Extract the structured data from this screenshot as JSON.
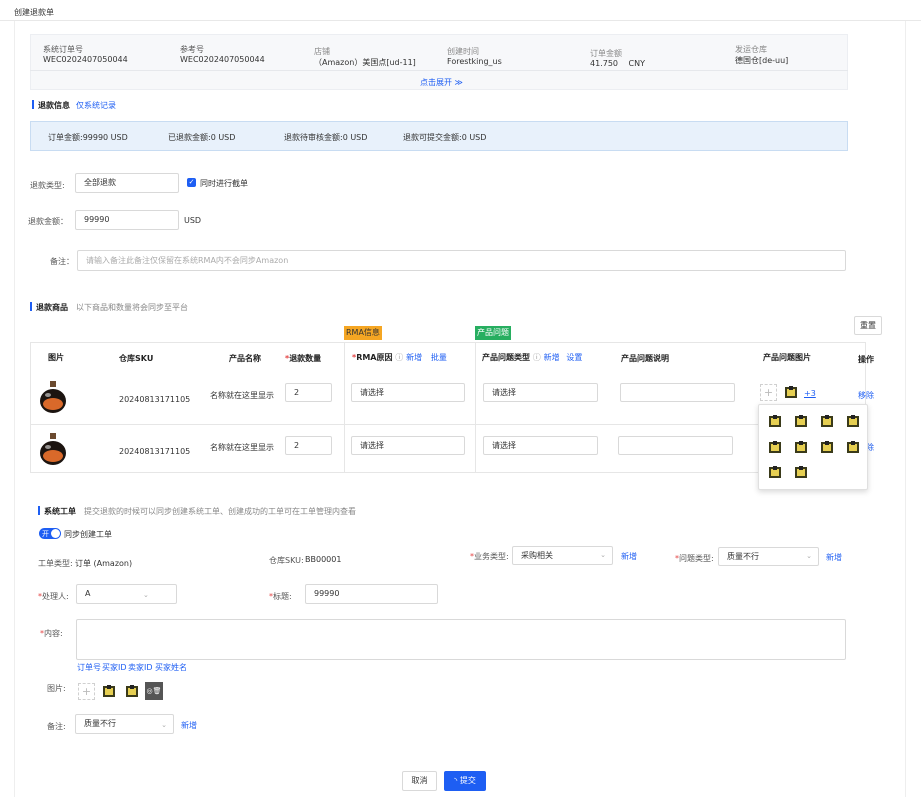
{
  "page": {
    "title": "创建退款单"
  },
  "summary": {
    "fields": [
      {
        "label": "系统订单号",
        "value": "WEC0202407050044"
      },
      {
        "label": "参考号",
        "value": "WEC0202407050044"
      },
      {
        "label": "店铺",
        "value": "（Amazon）美国点[ud-11]"
      },
      {
        "label": "创建时间",
        "value": "Forestking_us"
      },
      {
        "label": "订单金额",
        "value": "41.750",
        "unit": "CNY"
      },
      {
        "label": "发运仓库",
        "value": "德国仓[de-uu]"
      }
    ],
    "expand_label": "点击展开 ≫"
  },
  "refund_info": {
    "title": "退款信息",
    "link": "仅系统记录",
    "amounts": [
      "订单金额:99990 USD",
      "已退款金额:0 USD",
      "退款待审核金额:0 USD",
      "退款可提交金额:0 USD"
    ]
  },
  "form": {
    "refund_type_label": "退款类型:",
    "refund_type_value": "全部退款",
    "intercept_label": "同时进行截单",
    "refund_amount_label": "退款金额：",
    "refund_amount_value": "99990",
    "refund_amount_unit": "USD",
    "remark_label": "备注：",
    "remark_placeholder": "请输入备注此备注仅保留在系统RMA内不会同步Amazon"
  },
  "refund_goods": {
    "title": "退款商品",
    "subtitle": "以下商品和数量将会同步至平台",
    "reset_label": "重置",
    "tag_rma": "RMA信息",
    "tag_problem": "产品问题",
    "columns": {
      "image": "图片",
      "sku": "仓库SKU",
      "name": "产品名称",
      "qty": "退款数量",
      "rma": "RMA原因",
      "rma_add": "新增",
      "rma_batch": "批量",
      "ptype": "产品问题类型",
      "ptype_add": "新增",
      "ptype_set": "设置",
      "pdesc": "产品问题说明",
      "pimg": "产品问题图片",
      "action": "操作"
    },
    "rows": [
      {
        "sku": "20240813171105",
        "name": "名称就在这里显示",
        "qty": "2",
        "rma": "请选择",
        "ptype": "请选择",
        "more": "+3",
        "action": "移除"
      },
      {
        "sku": "20240813171105",
        "name": "名称就在这里显示",
        "qty": "2",
        "rma": "请选择",
        "ptype": "请选择",
        "action": "除"
      }
    ]
  },
  "work_order": {
    "title": "系统工单",
    "subtitle": "提交退款的时候可以同步创建系统工单、创建成功的工单可在工单管理内查看",
    "toggle_label": "开",
    "sync_label": "同步创建工单",
    "type_label": "工单类型:",
    "type_value": "订单 (Amazon)",
    "sku_label": "仓库SKU:",
    "sku_value": "BB00001",
    "biz_label": "业务类型:",
    "biz_value": "采购相关",
    "biz_add": "新增",
    "problem_label": "问题类型:",
    "problem_value": "质量不行",
    "problem_add": "新增",
    "handler_label": "处理人:",
    "handler_value": "A",
    "subject_label": "标题:",
    "subject_value": "99990",
    "content_label": "内容:",
    "vars": [
      "订单号",
      "买家ID",
      "卖家ID",
      "买家姓名"
    ],
    "image_label": "图片:",
    "remark_label": "备注:",
    "remark_value": "质量不行",
    "remark_add": "新增"
  },
  "footer": {
    "cancel_label": "取消",
    "submit_label": "提交"
  }
}
